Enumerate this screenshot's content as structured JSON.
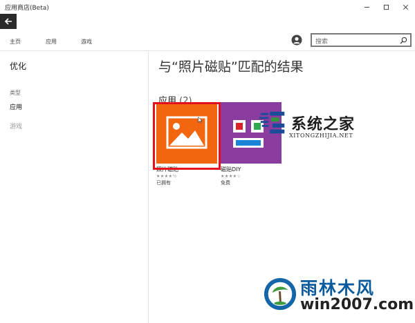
{
  "window": {
    "title": "应用商店(Beta)"
  },
  "nav": {
    "tabs": [
      "主页",
      "应用",
      "游戏"
    ],
    "search_placeholder": "搜索"
  },
  "sidebar": {
    "heading": "优化",
    "category_label": "类型",
    "items": [
      {
        "label": "应用",
        "active": true
      },
      {
        "label": "游戏",
        "active": false
      }
    ]
  },
  "main": {
    "title": "与“照片磁贴”匹配的结果",
    "section_label": "应用",
    "section_count": "(2)",
    "apps": [
      {
        "name": "照片磁贴",
        "rating": "★★★★½",
        "status": "已拥有",
        "tile_color": "#f1660f"
      },
      {
        "name": "磁贴DIY",
        "rating": "★★★★☆",
        "status": "免费",
        "tile_color": "#8b3d9f"
      }
    ]
  },
  "watermarks": {
    "top_brand": "系统之家",
    "top_sub": "XITONGZHIJIA.NET",
    "bottom_brand": "雨林木风",
    "bottom_sub": "win2007.com"
  },
  "colors": {
    "accent_orange": "#f1660f",
    "accent_purple": "#8b3d9f",
    "highlight_red": "#e3101b"
  }
}
